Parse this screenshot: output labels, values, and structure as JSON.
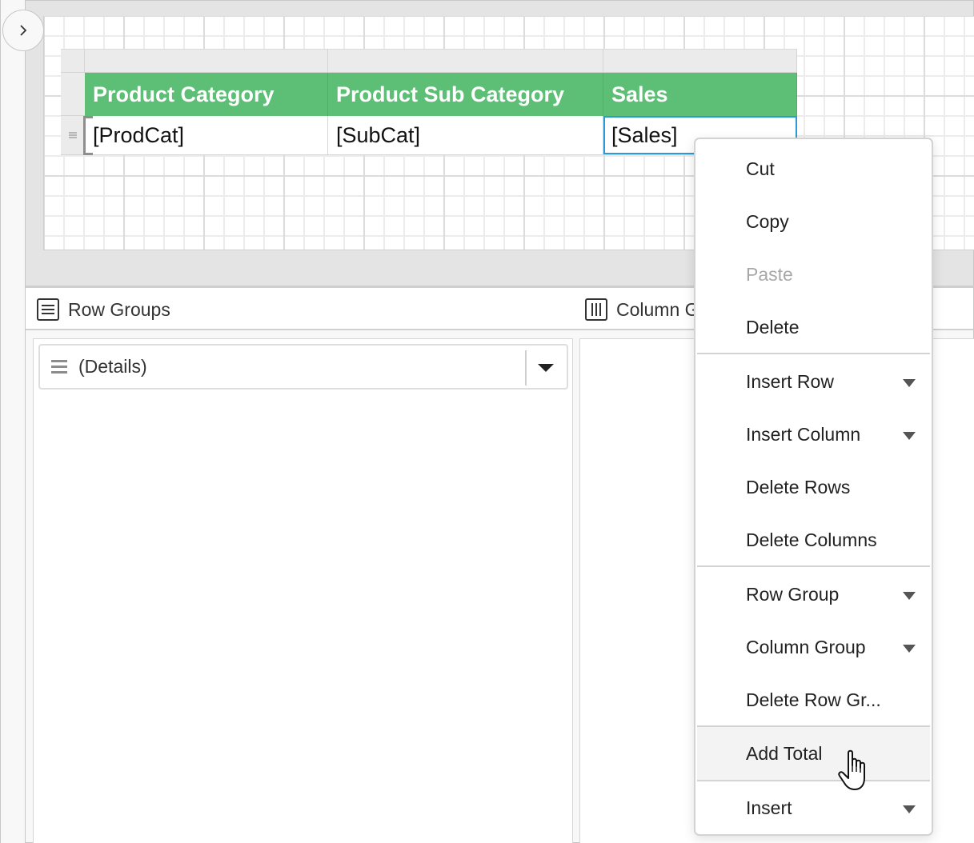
{
  "designer": {
    "expand_button_label": ">",
    "tablix": {
      "columns": [
        {
          "header": "Product Category",
          "field": "[ProdCat]"
        },
        {
          "header": "Product Sub Category",
          "field": "[SubCat]"
        },
        {
          "header": "Sales",
          "field": "[Sales]"
        }
      ],
      "header_color": "#5dbf76",
      "selected_cell": "[Sales]",
      "selection_color": "#2a9bd6"
    }
  },
  "groups": {
    "row_groups_title": "Row Groups",
    "column_groups_title": "Column Groups",
    "row_group_items": [
      {
        "label": "(Details)"
      }
    ]
  },
  "context_menu": {
    "items": [
      {
        "label": "Cut",
        "enabled": true,
        "submenu": false
      },
      {
        "label": "Copy",
        "enabled": true,
        "submenu": false
      },
      {
        "label": "Paste",
        "enabled": false,
        "submenu": false
      },
      {
        "label": "Delete",
        "enabled": true,
        "submenu": false
      },
      {
        "label": "Insert Row",
        "enabled": true,
        "submenu": true
      },
      {
        "label": "Insert Column",
        "enabled": true,
        "submenu": true
      },
      {
        "label": "Delete Rows",
        "enabled": true,
        "submenu": false
      },
      {
        "label": "Delete Columns",
        "enabled": true,
        "submenu": false
      },
      {
        "label": "Row Group",
        "enabled": true,
        "submenu": true
      },
      {
        "label": "Column Group",
        "enabled": true,
        "submenu": true
      },
      {
        "label": "Delete Row Gr...",
        "enabled": true,
        "submenu": false
      },
      {
        "label": "Add Total",
        "enabled": true,
        "submenu": false,
        "hovered": true
      },
      {
        "label": "Insert",
        "enabled": true,
        "submenu": true
      }
    ]
  }
}
